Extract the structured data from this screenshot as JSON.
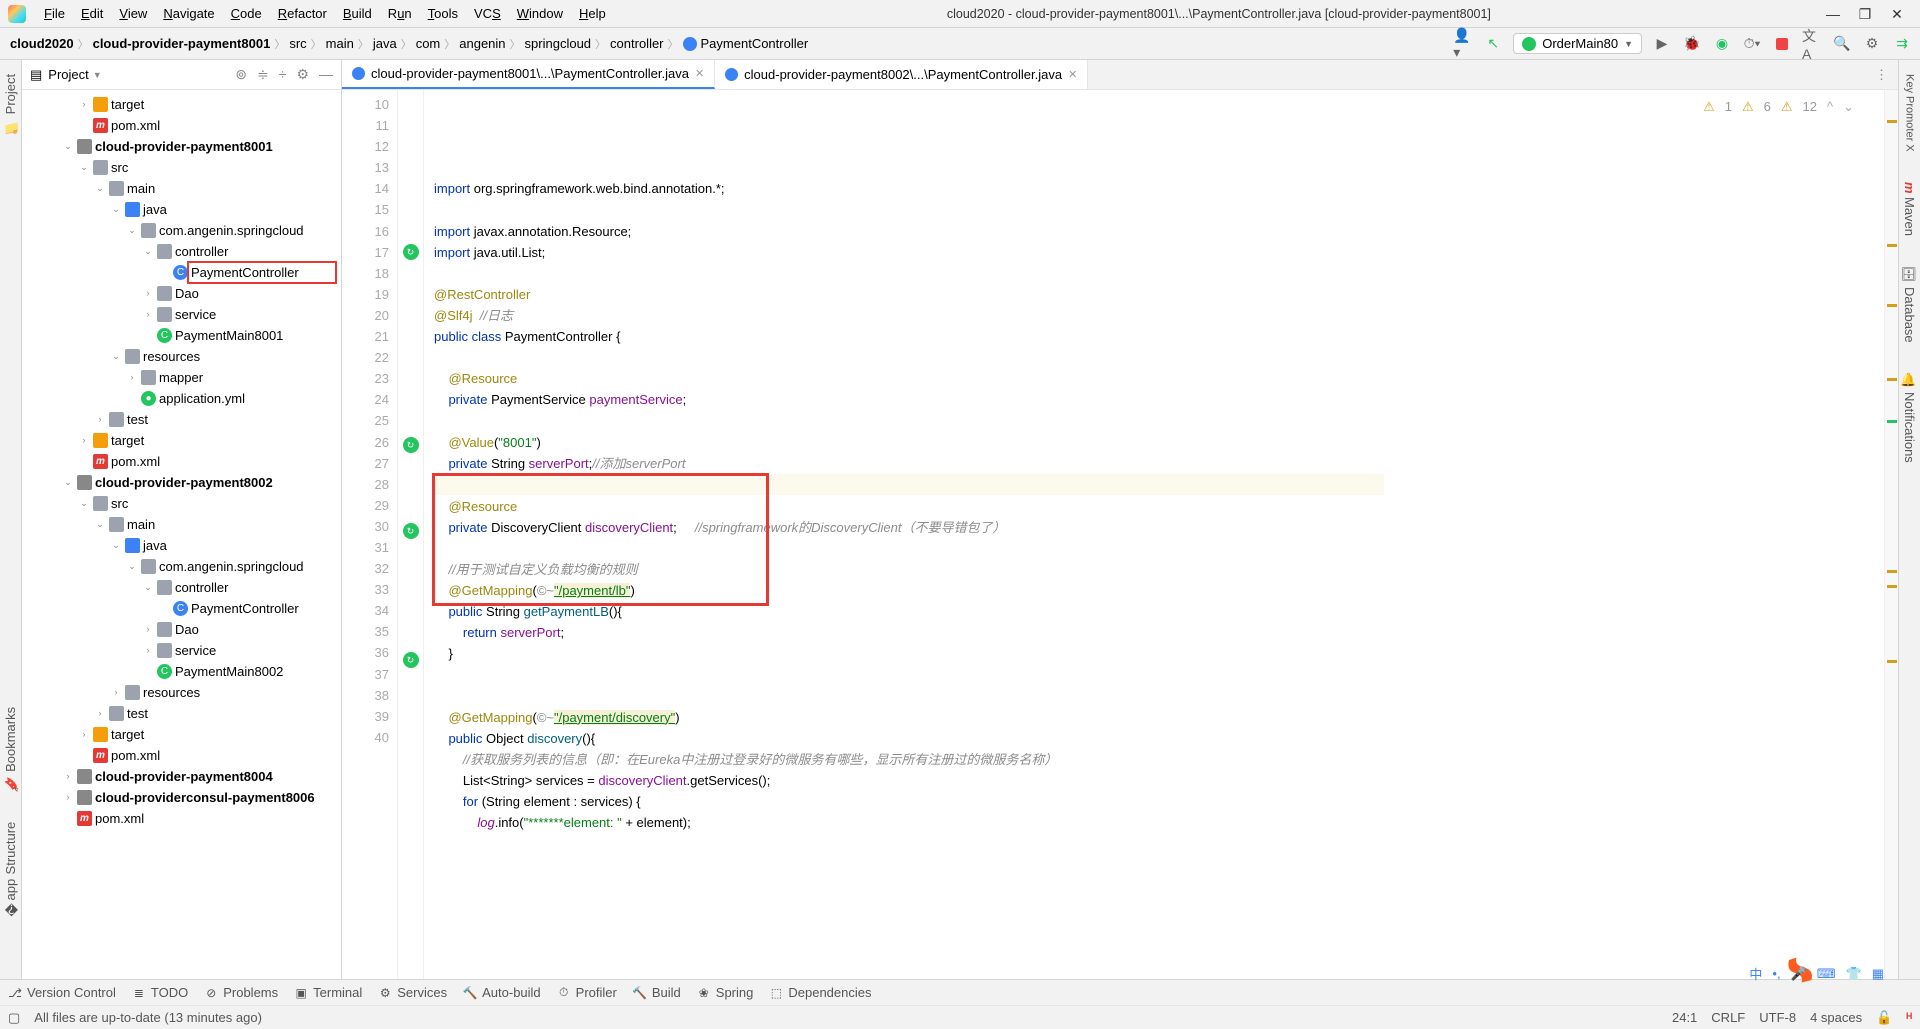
{
  "menu": {
    "file": "File",
    "edit": "Edit",
    "view": "View",
    "navigate": "Navigate",
    "code": "Code",
    "refactor": "Refactor",
    "build": "Build",
    "run": "Run",
    "tools": "Tools",
    "vcs": "VCS",
    "window": "Window",
    "help": "Help"
  },
  "window_title": "cloud2020 - cloud-provider-payment8001\\...\\PaymentController.java [cloud-provider-payment8001]",
  "breadcrumbs": [
    "cloud2020",
    "cloud-provider-payment8001",
    "src",
    "main",
    "java",
    "com",
    "angenin",
    "springcloud",
    "controller",
    "PaymentController"
  ],
  "run_config": "OrderMain80",
  "project_panel": {
    "title": "Project"
  },
  "tree": [
    {
      "d": 3,
      "t": "chev",
      "tx": "",
      "i": ""
    },
    {
      "d": 3,
      "t": "item",
      "tx": "target",
      "i": "folder orange",
      "tw": "›"
    },
    {
      "d": 3,
      "t": "item",
      "tx": "pom.xml",
      "i": "m"
    },
    {
      "d": 2,
      "t": "item",
      "tx": "cloud-provider-payment8001",
      "i": "folder",
      "tw": "⌄",
      "b": true
    },
    {
      "d": 3,
      "t": "item",
      "tx": "src",
      "i": "folder gray",
      "tw": "⌄"
    },
    {
      "d": 4,
      "t": "item",
      "tx": "main",
      "i": "folder gray",
      "tw": "⌄"
    },
    {
      "d": 5,
      "t": "item",
      "tx": "java",
      "i": "folder blue",
      "tw": "⌄"
    },
    {
      "d": 6,
      "t": "item",
      "tx": "com.angenin.springcloud",
      "i": "folder gray",
      "tw": "⌄"
    },
    {
      "d": 7,
      "t": "item",
      "tx": "controller",
      "i": "folder gray",
      "tw": "⌄"
    },
    {
      "d": 8,
      "t": "item",
      "tx": "PaymentController",
      "i": "c",
      "sel": true,
      "hl": true
    },
    {
      "d": 7,
      "t": "item",
      "tx": "Dao",
      "i": "folder gray",
      "tw": "›"
    },
    {
      "d": 7,
      "t": "item",
      "tx": "service",
      "i": "folder gray",
      "tw": "›"
    },
    {
      "d": 7,
      "t": "item",
      "tx": "PaymentMain8001",
      "i": "cspring"
    },
    {
      "d": 5,
      "t": "item",
      "tx": "resources",
      "i": "folder gray",
      "tw": "⌄"
    },
    {
      "d": 6,
      "t": "item",
      "tx": "mapper",
      "i": "folder gray",
      "tw": "›"
    },
    {
      "d": 6,
      "t": "item",
      "tx": "application.yml",
      "i": "yml"
    },
    {
      "d": 4,
      "t": "item",
      "tx": "test",
      "i": "folder gray",
      "tw": "›"
    },
    {
      "d": 3,
      "t": "item",
      "tx": "target",
      "i": "folder orange",
      "tw": "›"
    },
    {
      "d": 3,
      "t": "item",
      "tx": "pom.xml",
      "i": "m"
    },
    {
      "d": 2,
      "t": "item",
      "tx": "cloud-provider-payment8002",
      "i": "folder",
      "tw": "⌄",
      "b": true
    },
    {
      "d": 3,
      "t": "item",
      "tx": "src",
      "i": "folder gray",
      "tw": "⌄"
    },
    {
      "d": 4,
      "t": "item",
      "tx": "main",
      "i": "folder gray",
      "tw": "⌄"
    },
    {
      "d": 5,
      "t": "item",
      "tx": "java",
      "i": "folder blue",
      "tw": "⌄"
    },
    {
      "d": 6,
      "t": "item",
      "tx": "com.angenin.springcloud",
      "i": "folder gray",
      "tw": "⌄"
    },
    {
      "d": 7,
      "t": "item",
      "tx": "controller",
      "i": "folder gray",
      "tw": "⌄"
    },
    {
      "d": 8,
      "t": "item",
      "tx": "PaymentController",
      "i": "c"
    },
    {
      "d": 7,
      "t": "item",
      "tx": "Dao",
      "i": "folder gray",
      "tw": "›"
    },
    {
      "d": 7,
      "t": "item",
      "tx": "service",
      "i": "folder gray",
      "tw": "›"
    },
    {
      "d": 7,
      "t": "item",
      "tx": "PaymentMain8002",
      "i": "cspring"
    },
    {
      "d": 5,
      "t": "item",
      "tx": "resources",
      "i": "folder gray",
      "tw": "›"
    },
    {
      "d": 4,
      "t": "item",
      "tx": "test",
      "i": "folder gray",
      "tw": "›"
    },
    {
      "d": 3,
      "t": "item",
      "tx": "target",
      "i": "folder orange",
      "tw": "›"
    },
    {
      "d": 3,
      "t": "item",
      "tx": "pom.xml",
      "i": "m"
    },
    {
      "d": 2,
      "t": "item",
      "tx": "cloud-provider-payment8004",
      "i": "folder",
      "tw": "›",
      "b": true
    },
    {
      "d": 2,
      "t": "item",
      "tx": "cloud-providerconsul-payment8006",
      "i": "folder",
      "tw": "›",
      "b": true
    },
    {
      "d": 2,
      "t": "item",
      "tx": "pom.xml",
      "i": "m"
    }
  ],
  "tabs": [
    {
      "label": "cloud-provider-payment8001\\...\\PaymentController.java",
      "active": true
    },
    {
      "label": "cloud-provider-payment8002\\...\\PaymentController.java",
      "active": false
    }
  ],
  "inspections": {
    "warn1": "1",
    "warn2": "6",
    "weak": "12"
  },
  "code_lines": {
    "start": 10,
    "lines": [
      {
        "n": 10,
        "html": "<span class='kw'>import</span> org.springframework.web.bind.annotation.*;"
      },
      {
        "n": 11,
        "html": ""
      },
      {
        "n": 12,
        "html": "<span class='kw'>import</span> javax.annotation.<span class='cls'>Resource</span>;"
      },
      {
        "n": 13,
        "html": "<span class='kw'>import</span> java.util.<span class='cls'>List</span>;"
      },
      {
        "n": 14,
        "html": ""
      },
      {
        "n": 15,
        "html": "<span class='ann'>@RestController</span>"
      },
      {
        "n": 16,
        "html": "<span class='ann'>@Slf4j</span>  <span class='com'>//日志</span>"
      },
      {
        "n": 17,
        "html": "<span class='kw'>public class</span> <span class='cls'>PaymentController</span> {",
        "mark": "run"
      },
      {
        "n": 18,
        "html": ""
      },
      {
        "n": 19,
        "html": "    <span class='ann'>@Resource</span>"
      },
      {
        "n": 20,
        "html": "    <span class='kw'>private</span> PaymentService <span class='fld'>paymentService</span>;"
      },
      {
        "n": 21,
        "html": ""
      },
      {
        "n": 22,
        "html": "    <span class='ann'>@Value</span>(<span class='str'>\"8001\"</span>)"
      },
      {
        "n": 23,
        "html": "    <span class='kw'>private</span> String <span class='fld'>serverPort</span>;<span class='com'>//添加serverPort</span>"
      },
      {
        "n": 24,
        "html": "",
        "cur": true
      },
      {
        "n": 25,
        "html": "    <span class='ann'>@Resource</span>"
      },
      {
        "n": 26,
        "html": "    <span class='kw'>private</span> DiscoveryClient <span class='fld'>discoveryClient</span>;     <span class='com'>//springframework的DiscoveryClient（不要导错包了）</span>",
        "mark": "run"
      },
      {
        "n": 27,
        "html": ""
      },
      {
        "n": 28,
        "html": "    <span class='com'>//用于测试自定义负载均衡的规则</span>"
      },
      {
        "n": 29,
        "html": "    <span class='ann'>@GetMapping</span>(<span style='color:#888'>©~</span><span class='str u'>\"/payment/lb\"</span>)"
      },
      {
        "n": 30,
        "html": "    <span class='kw'>public</span> String <span class='mtd'>getPaymentLB</span>(){",
        "mark": "run"
      },
      {
        "n": 31,
        "html": "        <span class='kw'>return</span> <span class='fld'>serverPort</span>;"
      },
      {
        "n": 32,
        "html": "    }"
      },
      {
        "n": 33,
        "html": ""
      },
      {
        "n": 34,
        "html": ""
      },
      {
        "n": 35,
        "html": "    <span class='ann'>@GetMapping</span>(<span style='color:#888'>©~</span><span class='str u'>\"/payment/discovery\"</span>)"
      },
      {
        "n": 36,
        "html": "    <span class='kw'>public</span> Object <span class='mtd'>discovery</span>(){",
        "mark": "run"
      },
      {
        "n": 37,
        "html": "        <span class='com'>//获取服务列表的信息（即：在Eureka中注册过登录好的微服务有哪些，显示所有注册过的微服务名称）</span>"
      },
      {
        "n": 38,
        "html": "        List&lt;String&gt; services = <span class='fld'>discoveryClient</span>.getServices();"
      },
      {
        "n": 39,
        "html": "        <span class='kw'>for</span> (String element : services) {"
      },
      {
        "n": 40,
        "html": "            <span class='fld' style='font-style:italic'>log</span>.info(<span class='str'>\"*******element: \"</span> + element);"
      }
    ]
  },
  "bottom_tabs": [
    "Version Control",
    "TODO",
    "Problems",
    "Terminal",
    "Services",
    "Auto-build",
    "Profiler",
    "Build",
    "Spring",
    "Dependencies"
  ],
  "status": {
    "msg": "All files are up-to-date (13 minutes ago)",
    "pos": "24:1",
    "eol": "CRLF",
    "enc": "UTF-8",
    "indent": "4 spaces"
  },
  "side_tabs_left": [
    "Project",
    "Bookmarks",
    "Structure"
  ],
  "side_tabs_right": [
    "Key Promoter X",
    "Maven",
    "Database",
    "Notifications"
  ]
}
